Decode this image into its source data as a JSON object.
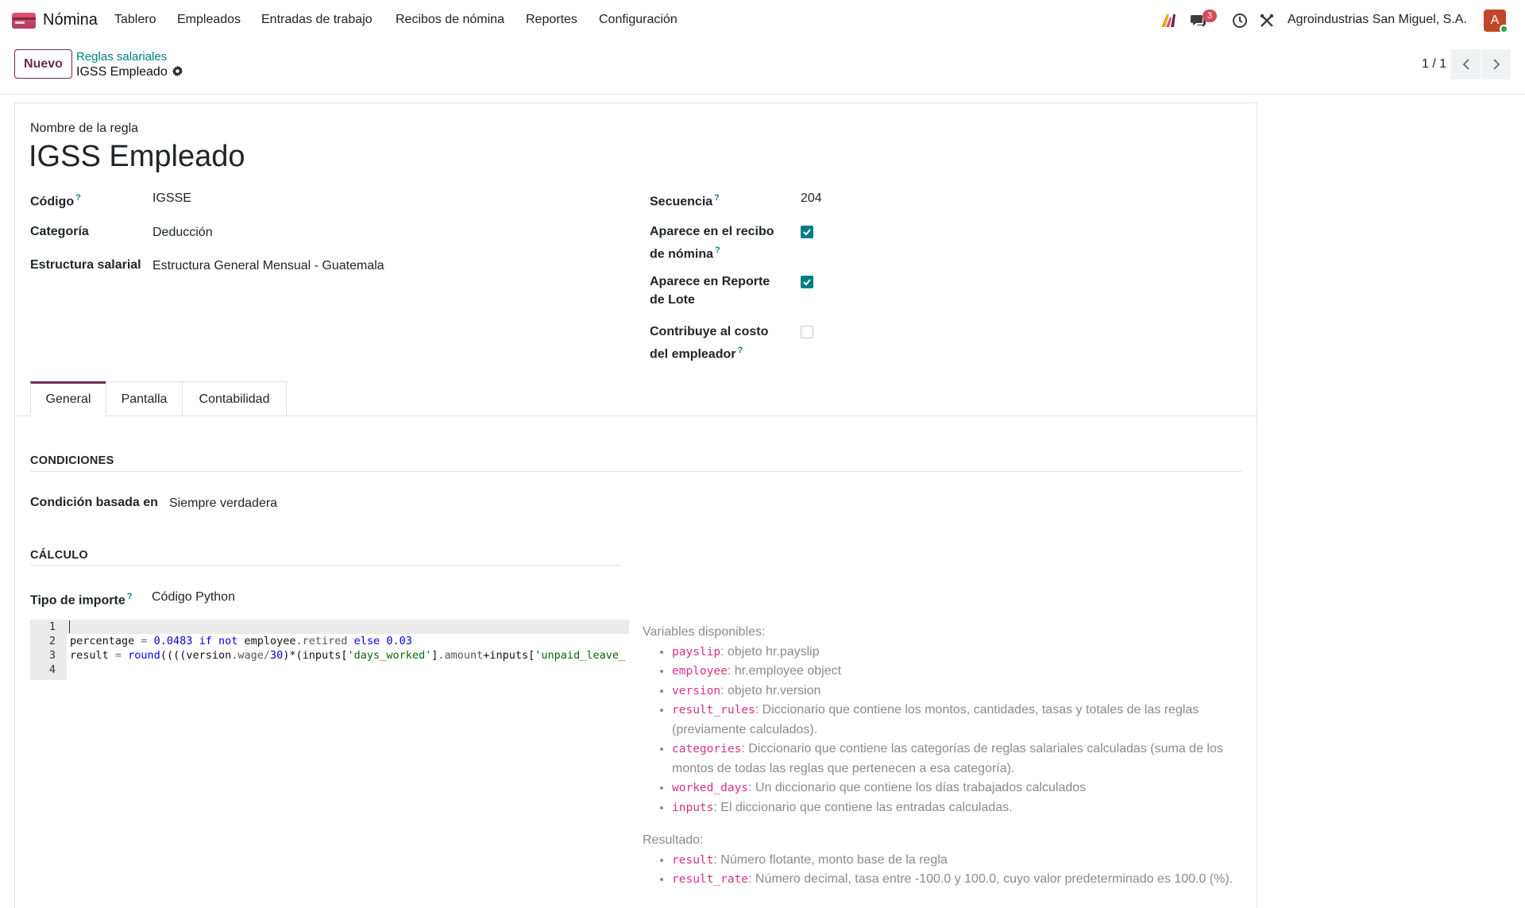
{
  "nav": {
    "app_name": "Nómina",
    "menu": [
      "Tablero",
      "Empleados",
      "Entradas de trabajo",
      "Recibos de nómina",
      "Reportes",
      "Configuración"
    ],
    "messages_badge": "3",
    "company": "Agroindustrias San Miguel, S.A.",
    "avatar_letter": "A"
  },
  "control": {
    "new_button": "Nuevo",
    "breadcrumb_parent": "Reglas salariales",
    "breadcrumb_current": "IGSS Empleado",
    "pager": "1 / 1"
  },
  "form": {
    "rule_name_label": "Nombre de la regla",
    "rule_name": "IGSS Empleado",
    "code_label": "Código",
    "code_value": "IGSSE",
    "category_label": "Categoría",
    "category_value": "Deducción",
    "structure_label": "Estructura salarial",
    "structure_value": "Estructura General Mensual - Guatemala",
    "sequence_label": "Secuencia",
    "sequence_value": "204",
    "appears_payslip_label_1": "Aparece en el recibo",
    "appears_payslip_label_2": "de nómina",
    "appears_payslip": true,
    "appears_batch_label_1": "Aparece en Reporte",
    "appears_batch_label_2": "de Lote",
    "appears_batch": true,
    "employer_cost_label_1": "Contribuye al costo",
    "employer_cost_label_2": "del empleador",
    "employer_cost": false,
    "help_mark": "?"
  },
  "tabs": [
    "General",
    "Pantalla",
    "Contabilidad"
  ],
  "conditions": {
    "title": "CONDICIONES",
    "condition_label": "Condición basada en",
    "condition_value": "Siempre verdadera"
  },
  "calculation": {
    "title": "CÁLCULO",
    "amount_type_label": "Tipo de importe",
    "amount_type_value": "Código Python"
  },
  "code": {
    "line_numbers": [
      "1",
      "2",
      "3",
      "4"
    ],
    "line2": {
      "a": "percentage",
      "b": " = ",
      "c": "0.0483",
      "d": " if ",
      "e": "not",
      "f": " employee",
      "g": ".retired",
      "h": " else ",
      "i": "0.03"
    },
    "line3": {
      "a": "result",
      "b": " = ",
      "c": "round",
      "d": "((((version",
      "e": ".wage",
      "f": "/",
      "g": "30",
      "h": ")*(inputs[",
      "i": "'days_worked'",
      "j": "]",
      "k": ".amount",
      "l": "+inputs[",
      "m": "'unpaid_leave_"
    }
  },
  "help": {
    "variables_title": "Variables disponibles:",
    "variables": [
      {
        "name": "payslip",
        "desc": ": objeto hr.payslip"
      },
      {
        "name": "employee",
        "desc": ": hr.employee object"
      },
      {
        "name": "version",
        "desc": ": objeto hr.version"
      },
      {
        "name": "result_rules",
        "desc": ": Diccionario que contiene los montos, cantidades, tasas y totales de las reglas (previamente calculados)."
      },
      {
        "name": "categories",
        "desc": ": Diccionario que contiene las categorías de reglas salariales calculadas (suma de los montos de todas las reglas que pertenecen a esa categoría)."
      },
      {
        "name": "worked_days",
        "desc": ": Un diccionario que contiene los días trabajados calculados"
      },
      {
        "name": "inputs",
        "desc": ": El diccionario que contiene las entradas calculadas."
      }
    ],
    "result_title": "Resultado:",
    "results": [
      {
        "name": "result",
        "desc": ": Número flotante, monto base de la regla"
      },
      {
        "name": "result_rate",
        "desc": ": Número decimal, tasa entre -100.0 y 100.0, cuyo valor predeterminado es 100.0 (%)."
      }
    ]
  },
  "colors": {
    "brand": "#6c2a52",
    "accent": "#017e84",
    "badge": "#d44c59",
    "code_var": "#d63384"
  }
}
